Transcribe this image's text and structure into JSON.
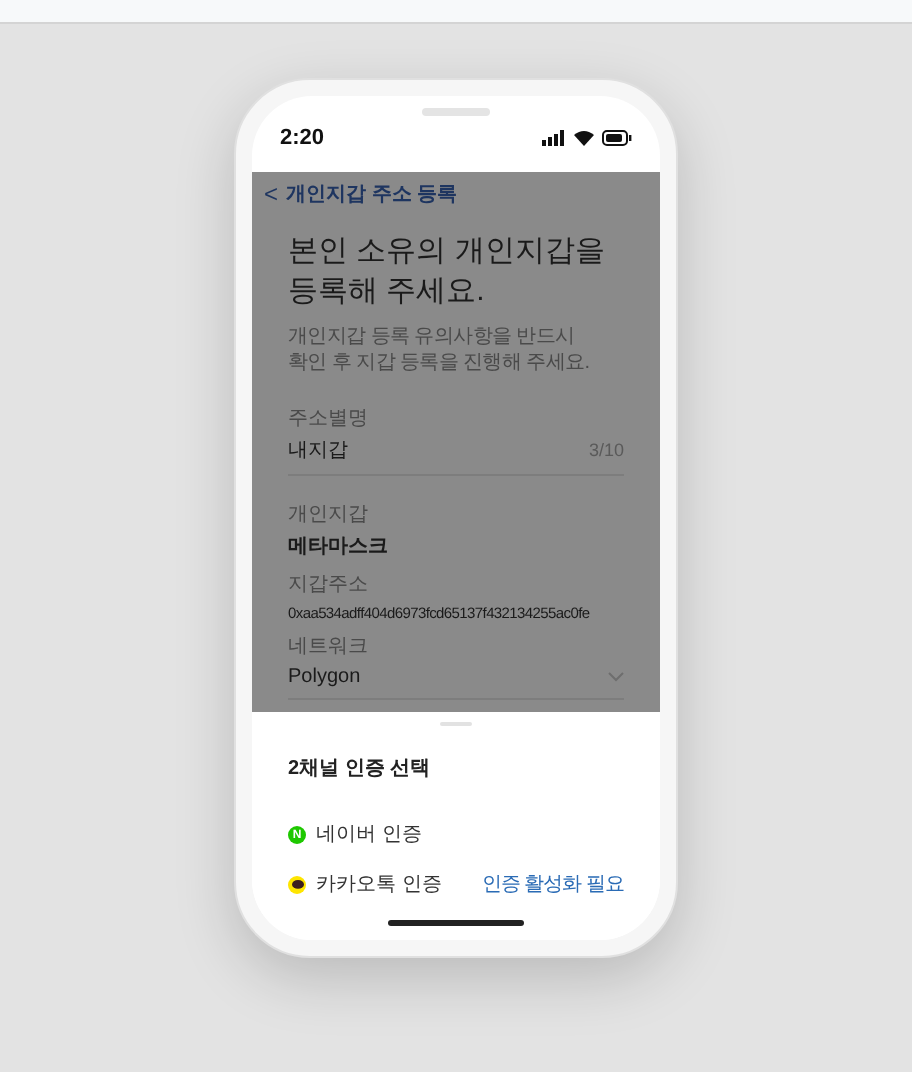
{
  "status_bar": {
    "time": "2:20"
  },
  "header": {
    "back_icon": "<",
    "title": "개인지갑 주소 등록"
  },
  "heading": "본인 소유의 개인지갑을\n등록해 주세요.",
  "subtitle": "개인지갑 등록 유의사항을 반드시\n확인 후 지갑 등록을 진행해 주세요.",
  "alias_field": {
    "label": "주소별명",
    "value": "내지갑",
    "counter": "3/10"
  },
  "wallet": [
    {
      "label": "개인지갑",
      "value": "메타마스크"
    },
    {
      "label": "지갑주소",
      "value": "0xaa534adff404d6973fcd65137f432134255ac0fe"
    }
  ],
  "network": {
    "label": "네트워크",
    "value": "Polygon"
  },
  "sheet": {
    "title": "2채널 인증 선택",
    "options": [
      {
        "kind": "naver",
        "badge": "N",
        "label": "네이버 인증"
      },
      {
        "kind": "kakao",
        "label": "카카오톡 인증",
        "status": "인증 활성화 필요"
      }
    ]
  }
}
